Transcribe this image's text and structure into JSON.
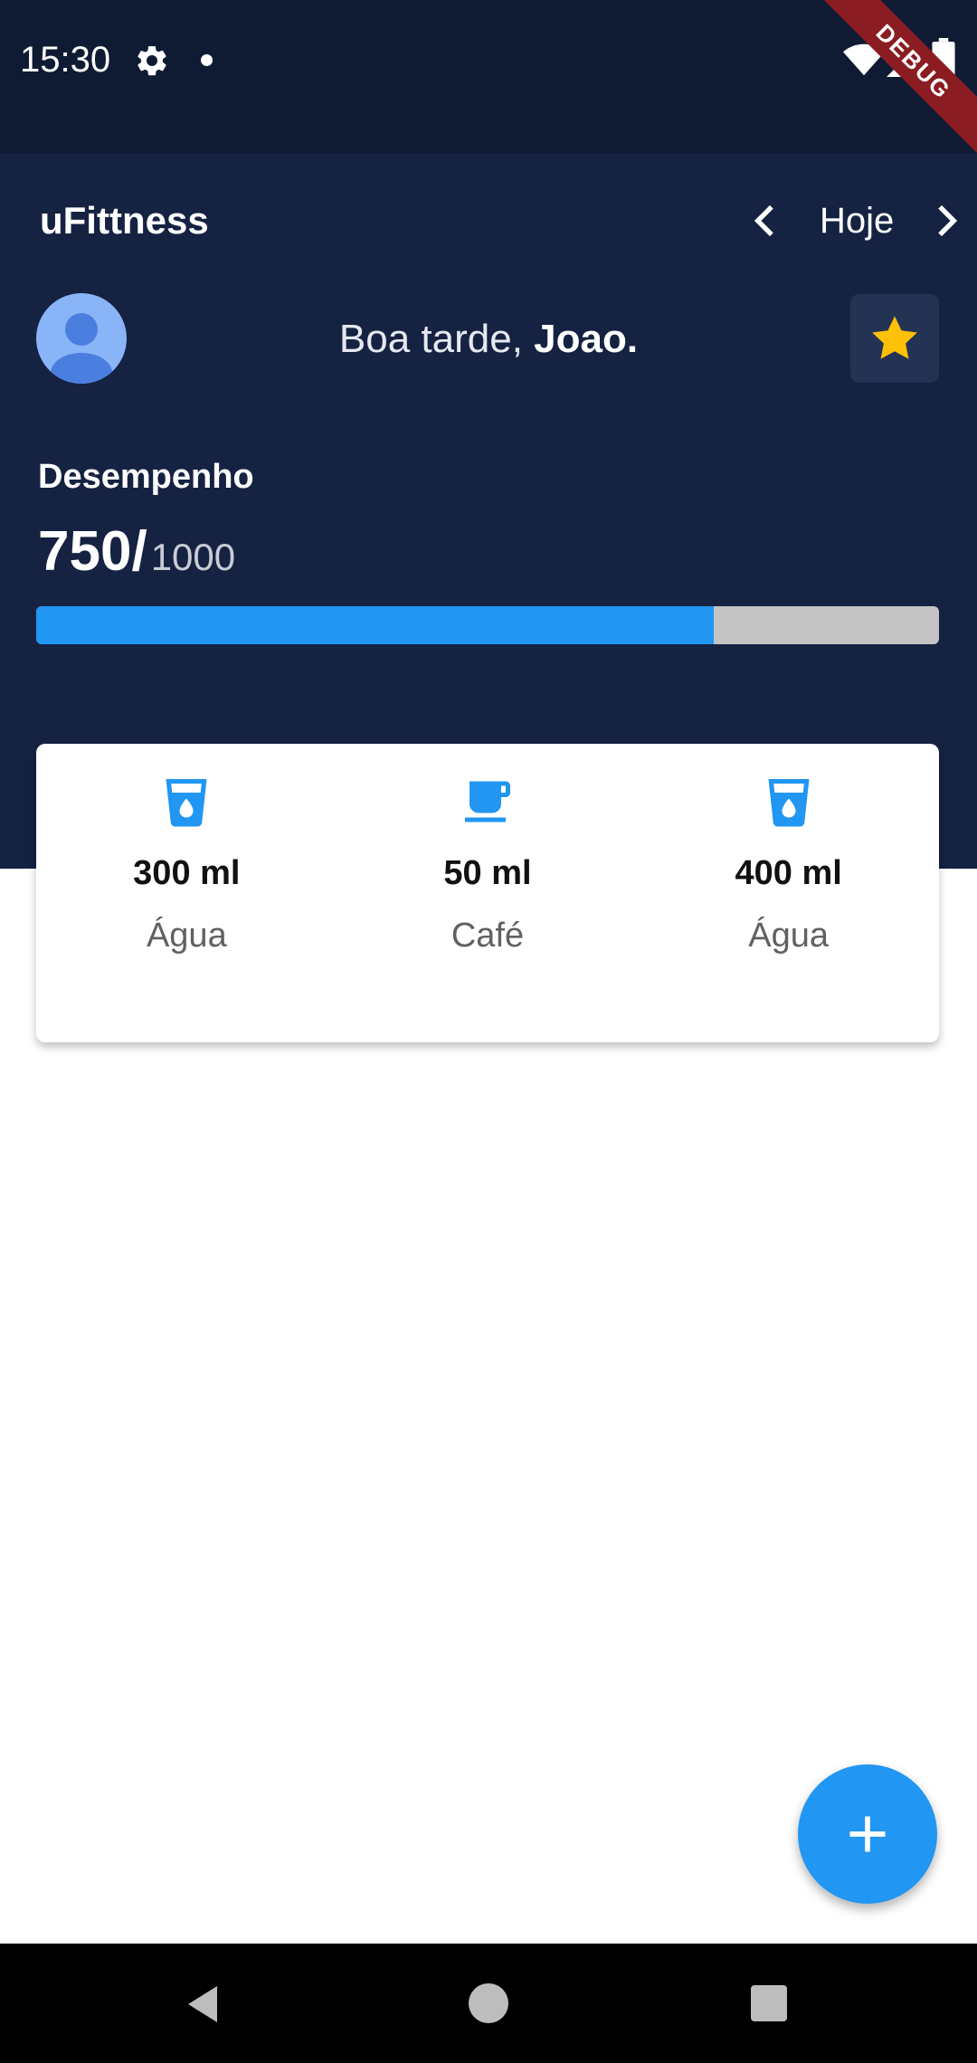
{
  "status_bar": {
    "time": "15:30",
    "icons": [
      "gear-icon",
      "dot-icon",
      "wifi-icon",
      "signal-icon",
      "battery-icon"
    ]
  },
  "debug_banner": "DEBUG",
  "header": {
    "app_title": "uFittness",
    "date_nav": {
      "label": "Hoje",
      "prev_icon": "chevron-left-icon",
      "next_icon": "chevron-right-icon"
    },
    "greeting_prefix": "Boa tarde, ",
    "user_name": "Joao.",
    "favorite_icon": "star-icon"
  },
  "performance": {
    "label": "Desempenho",
    "current": "750",
    "separator": "/",
    "total": "1000",
    "progress_fraction": 0.75
  },
  "drinks": [
    {
      "amount": "300 ml",
      "type": "Água",
      "icon": "water-glass-icon"
    },
    {
      "amount": "50 ml",
      "type": "Café",
      "icon": "coffee-cup-icon"
    },
    {
      "amount": "400 ml",
      "type": "Água",
      "icon": "water-glass-icon"
    }
  ],
  "fab": {
    "icon": "plus-icon"
  },
  "nav_bar": {
    "icons": [
      "back-icon",
      "home-icon",
      "recents-icon"
    ]
  },
  "colors": {
    "status_bg": "#0f1a33",
    "header_bg": "#152242",
    "accent": "#2196f3",
    "star": "#ffc107",
    "progress_track": "#c4c4c4"
  }
}
